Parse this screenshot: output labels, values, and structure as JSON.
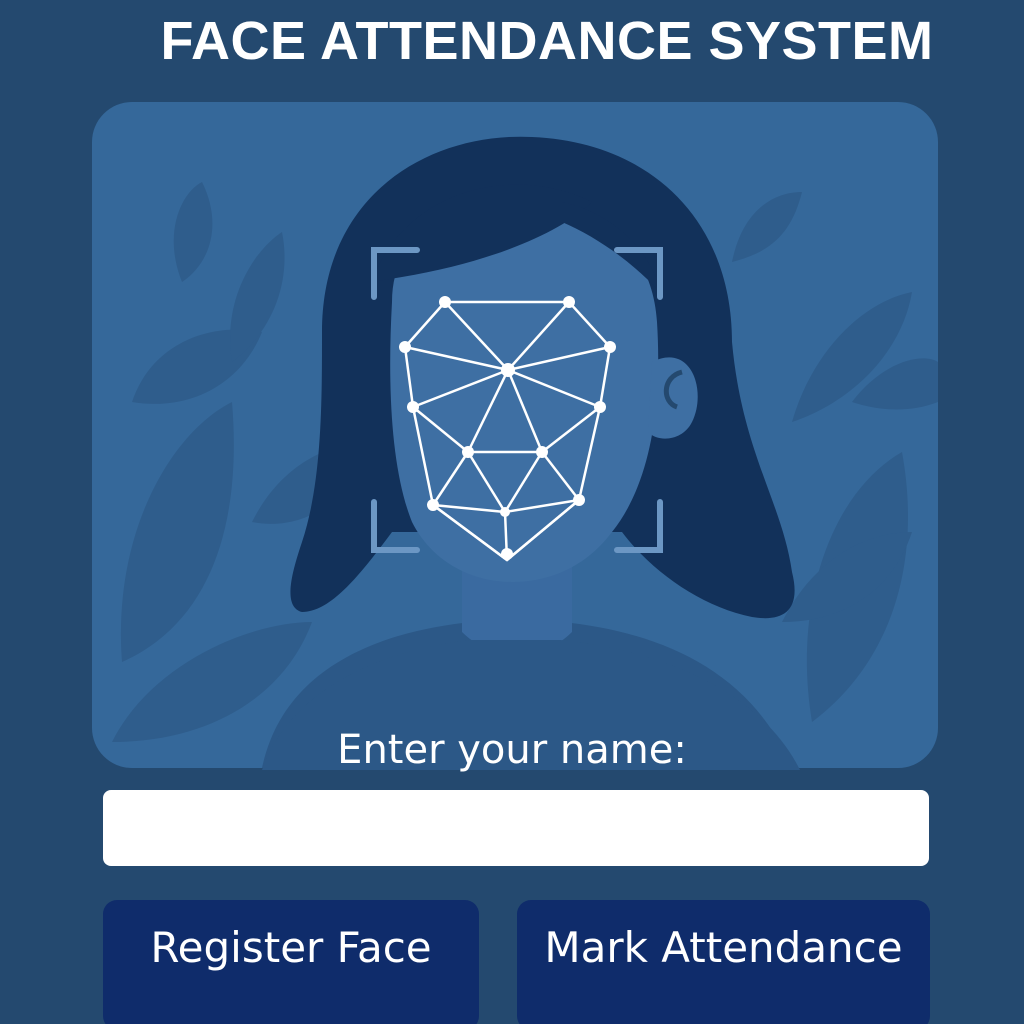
{
  "app": {
    "title": "FACE ATTENDANCE SYSTEM"
  },
  "illustration": {
    "icon": "face-scan-illustration",
    "colors": {
      "background": "#24496f",
      "panel": "#35689a",
      "leaf": "#2d5a88",
      "hair": "#12315a",
      "skin": "#3e6fa3",
      "mesh": "#ffffff"
    }
  },
  "form": {
    "name_label": "Enter your name:",
    "name_value": "",
    "name_placeholder": ""
  },
  "actions": {
    "register_label": "Register Face",
    "mark_label": "Mark Attendance",
    "button_color": "#0f2c6b"
  }
}
